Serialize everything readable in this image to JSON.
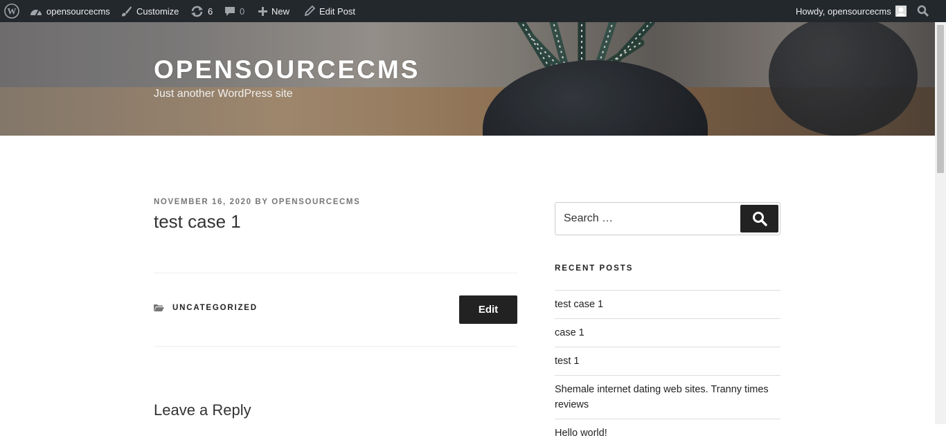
{
  "admin_bar": {
    "site_name": "opensourcecms",
    "customize": "Customize",
    "updates_count": "6",
    "comments_count": "0",
    "new_label": "New",
    "edit_post": "Edit Post",
    "howdy": "Howdy, opensourcecms"
  },
  "header": {
    "site_title": "OPENSOURCECMS",
    "tagline": "Just another WordPress site"
  },
  "post": {
    "date": "NOVEMBER 16, 2020",
    "by": "BY",
    "author": "OPENSOURCECMS",
    "title": "test case 1",
    "category": "UNCATEGORIZED",
    "edit_label": "Edit",
    "reply_title": "Leave a Reply"
  },
  "sidebar": {
    "search_placeholder": "Search …",
    "recent_posts_title": "RECENT POSTS",
    "recent_posts": [
      "test case 1",
      "case 1",
      "test 1",
      "Shemale internet dating web sites. Tranny times reviews",
      "Hello world!"
    ]
  },
  "colors": {
    "admin_bar_bg": "#23282d",
    "button_bg": "#222222"
  }
}
